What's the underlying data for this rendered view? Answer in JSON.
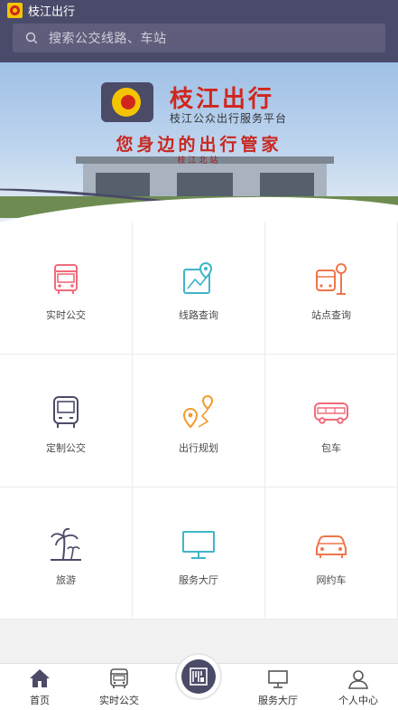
{
  "app": {
    "title": "枝江出行"
  },
  "search": {
    "placeholder": "搜索公交线路、车站"
  },
  "banner": {
    "brand_name": "枝江出行",
    "brand_subtitle": "枝江公众出行服务平台",
    "slogan": "您身边的出行管家",
    "station_sign": "枝江北站"
  },
  "services": [
    {
      "label": "实时公交",
      "icon": "bus-icon",
      "color": "#f06b7a"
    },
    {
      "label": "线路查询",
      "icon": "route-map-icon",
      "color": "#3fb5c8"
    },
    {
      "label": "站点查询",
      "icon": "bus-stop-icon",
      "color": "#f0754a"
    },
    {
      "label": "定制公交",
      "icon": "custom-bus-icon",
      "color": "#4b4b68"
    },
    {
      "label": "出行规划",
      "icon": "trip-plan-icon",
      "color": "#f29a2e"
    },
    {
      "label": "包车",
      "icon": "coach-icon",
      "color": "#f06b7a"
    },
    {
      "label": "旅游",
      "icon": "palm-tree-icon",
      "color": "#4b4b68"
    },
    {
      "label": "服务大厅",
      "icon": "monitor-icon",
      "color": "#3fb5c8"
    },
    {
      "label": "网约车",
      "icon": "car-icon",
      "color": "#f0754a"
    }
  ],
  "tabbar": {
    "items": [
      {
        "label": "首页",
        "icon": "home-icon",
        "active": true
      },
      {
        "label": "实时公交",
        "icon": "bus-icon"
      },
      {
        "label": "",
        "icon": "qr-scan-icon"
      },
      {
        "label": "服务大厅",
        "icon": "monitor-icon"
      },
      {
        "label": "个人中心",
        "icon": "user-icon"
      }
    ]
  }
}
